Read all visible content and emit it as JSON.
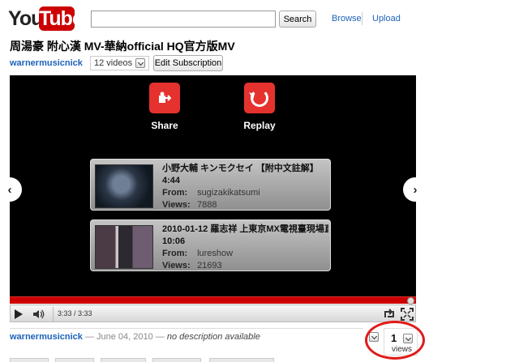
{
  "header": {
    "logo_you": "You",
    "logo_tube": "Tube",
    "search_value": "",
    "search_label": "Search",
    "nav_browse": "Browse",
    "nav_upload": "Upload"
  },
  "video": {
    "title": "周湯豪 附心漢 MV-華納official HQ官方版MV",
    "channel": "warnermusicnick",
    "videos_count": "12 videos",
    "edit_subscription": "Edit Subscription"
  },
  "player": {
    "share_label": "Share",
    "replay_label": "Replay",
    "time": "3:33 / 3:33",
    "progress_fraction": 1.0,
    "related": [
      {
        "title": "小野大輔 キンモクセイ 【附中文註解】",
        "duration": "4:44",
        "from_label": "From:",
        "from": "sugizakikatsumi",
        "views_label": "Views:",
        "views": "7888"
      },
      {
        "title": "2010-01-12 羅志祥 上東京MX電視臺現場直",
        "duration": "10:06",
        "from_label": "From:",
        "from": "lureshow",
        "views_label": "Views:",
        "views": "21693"
      }
    ]
  },
  "info": {
    "author": "warnermusicnick",
    "date": "— June 04, 2010 —",
    "description": "no description available",
    "views_count": "1",
    "views_label": "views"
  },
  "colors": {
    "accent_red": "#e5322e",
    "link_blue": "#1c62b9",
    "highlight": "#e01b1b"
  }
}
